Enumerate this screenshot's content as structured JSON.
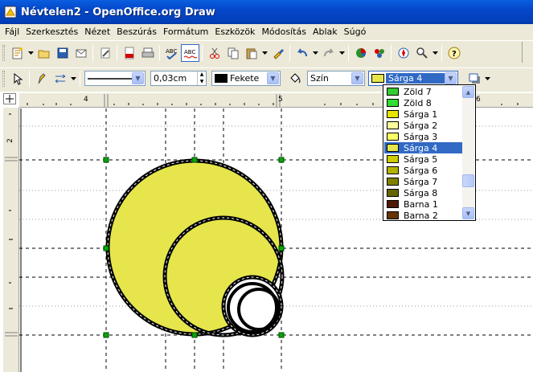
{
  "window": {
    "title": "Névtelen2 - OpenOffice.org Draw"
  },
  "menu": [
    {
      "label": "Fájl"
    },
    {
      "label": "Szerkesztés"
    },
    {
      "label": "Nézet"
    },
    {
      "label": "Beszúrás"
    },
    {
      "label": "Formátum"
    },
    {
      "label": "Eszközök"
    },
    {
      "label": "Módosítás"
    },
    {
      "label": "Ablak"
    },
    {
      "label": "Súgó"
    }
  ],
  "line_props": {
    "line_style": "",
    "line_width": "0,03cm",
    "line_color": {
      "label": "Fekete",
      "swatch": "#000000"
    },
    "area_style": "Szín",
    "area_color": {
      "label": "Sárga 4",
      "swatch": "#e6e64c"
    }
  },
  "rulers": {
    "h_labels": [
      "4",
      "5",
      "6"
    ],
    "v_labels": [
      "2"
    ]
  },
  "color_dropdown": {
    "items": [
      {
        "label": "Zöld 7",
        "color": "#33cc33"
      },
      {
        "label": "Zöld 8",
        "color": "#33dd33"
      },
      {
        "label": "Sárga 1",
        "color": "#e6e600"
      },
      {
        "label": "Sárga 2",
        "color": "#ffff99"
      },
      {
        "label": "Sárga 3",
        "color": "#ffff66"
      },
      {
        "label": "Sárga 4",
        "color": "#e6e64c",
        "selected": true
      },
      {
        "label": "Sárga 5",
        "color": "#cccc00"
      },
      {
        "label": "Sárga 6",
        "color": "#b3b300"
      },
      {
        "label": "Sárga 7",
        "color": "#808000"
      },
      {
        "label": "Sárga 8",
        "color": "#666600"
      },
      {
        "label": "Barna 1",
        "color": "#4d1a00"
      },
      {
        "label": "Barna 2",
        "color": "#663300"
      }
    ]
  },
  "drawing": {
    "fill_color": "#e6e64c",
    "stroke_color": "#000000",
    "handle_color": "#00aa00"
  }
}
